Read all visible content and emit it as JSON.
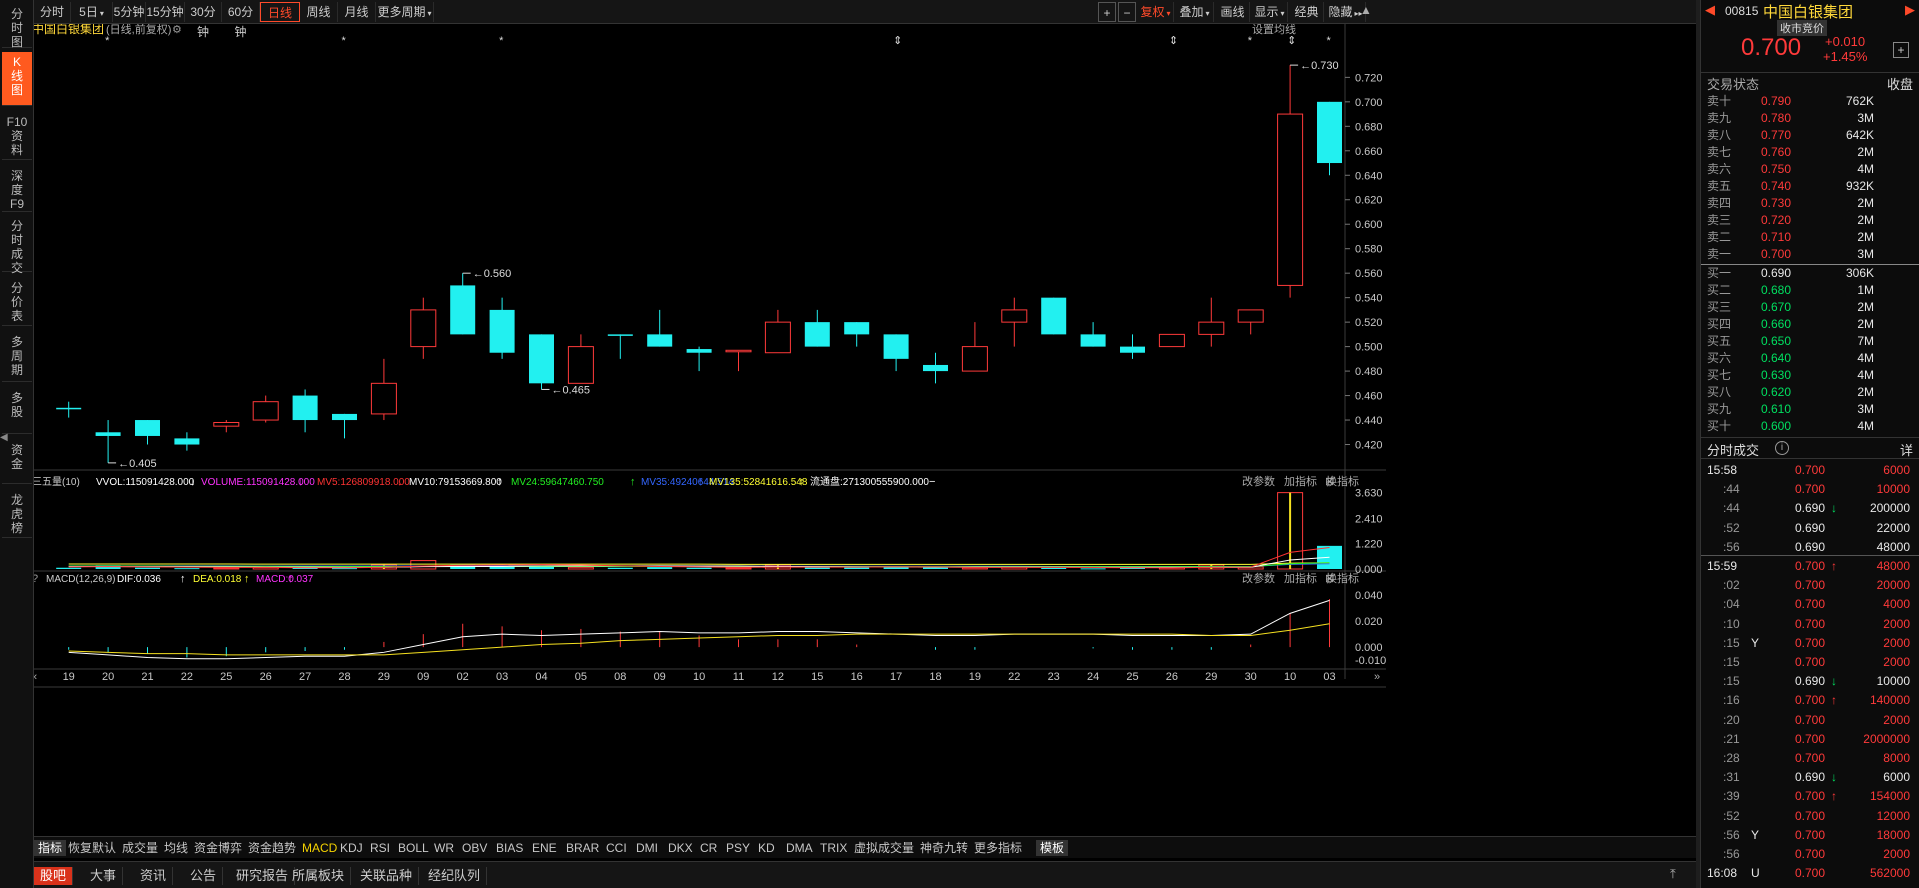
{
  "toolbar": {
    "left": [
      "分时",
      "5日",
      "5分钟",
      "15分钟",
      "30分钟",
      "60分钟",
      "日线",
      "周线",
      "月线",
      "更多周期"
    ],
    "right": [
      "+",
      "−",
      "复权",
      "叠加",
      "画线",
      "显示",
      "经典",
      "隐藏"
    ]
  },
  "leftnav": [
    {
      "label": "分\n时\n图"
    },
    {
      "label": "K\n线\n图"
    },
    {
      "label": "F10\n资\n料"
    },
    {
      "label": "深\n度\nF9"
    },
    {
      "label": "分\n时\n成\n交"
    },
    {
      "label": "分\n价\n表"
    },
    {
      "label": "多\n周\n期"
    },
    {
      "label": "多\n股"
    },
    {
      "label": "资\n金"
    },
    {
      "label": "龙\n虎\n榜"
    }
  ],
  "header": {
    "title": "中国白银集团",
    "subtitle": "(日线,前复权)",
    "settings": "设置均线"
  },
  "volume_header": {
    "name": "三五量(10)",
    "items": [
      "VVOL:115091428.000",
      "VOLUME:115091428.000",
      "MV5:126809918.000",
      "MV10:79153669.800",
      "MV24:59647460.750",
      "MV35:49240644.514",
      "MV135:52841616.548",
      "流通盘:271300555900.000"
    ],
    "colors": [
      "#ffffff",
      "#ff33ff",
      "#ff3333",
      "#ffffff",
      "#22ee22",
      "#3366ff",
      "#ffff33",
      "#ffffff"
    ],
    "arrows": [
      "↓",
      "↓",
      "↓",
      "↑",
      "↑",
      "↑",
      "↑",
      "−"
    ],
    "actions": [
      "改参数",
      "加指标",
      "换指标"
    ]
  },
  "macd_header": {
    "name": "MACD(12,26,9)",
    "items": [
      "DIF:0.036",
      "DEA:0.018",
      "MACD:0.037"
    ],
    "colors": [
      "#ffffff",
      "#ffff33",
      "#ff33ff"
    ],
    "arrows": [
      "↑",
      "↑",
      "↑"
    ],
    "actions": [
      "改参数",
      "加指标",
      "换指标"
    ]
  },
  "chart_data": {
    "type": "candlestick",
    "dates": [
      "19",
      "20",
      "21",
      "22",
      "25",
      "26",
      "27",
      "28",
      "29",
      "09",
      "02",
      "03",
      "04",
      "05",
      "08",
      "09",
      "10",
      "11",
      "12",
      "15",
      "16",
      "17",
      "18",
      "19",
      "22",
      "23",
      "24",
      "25",
      "26",
      "29",
      "30",
      "10",
      "03"
    ],
    "ohlc": [
      [
        0.45,
        0.455,
        0.442,
        0.45
      ],
      [
        0.43,
        0.44,
        0.405,
        0.427
      ],
      [
        0.44,
        0.44,
        0.42,
        0.427
      ],
      [
        0.425,
        0.43,
        0.415,
        0.42
      ],
      [
        0.435,
        0.44,
        0.43,
        0.438
      ],
      [
        0.44,
        0.46,
        0.438,
        0.455
      ],
      [
        0.46,
        0.465,
        0.43,
        0.44
      ],
      [
        0.445,
        0.445,
        0.425,
        0.44
      ],
      [
        0.445,
        0.49,
        0.44,
        0.47
      ],
      [
        0.5,
        0.54,
        0.49,
        0.53
      ],
      [
        0.55,
        0.56,
        0.51,
        0.51
      ],
      [
        0.53,
        0.54,
        0.49,
        0.495
      ],
      [
        0.51,
        0.51,
        0.465,
        0.47
      ],
      [
        0.47,
        0.51,
        0.47,
        0.5
      ],
      [
        0.51,
        0.51,
        0.49,
        0.51
      ],
      [
        0.51,
        0.53,
        0.5,
        0.5
      ],
      [
        0.498,
        0.5,
        0.48,
        0.495
      ],
      [
        0.496,
        0.497,
        0.48,
        0.497
      ],
      [
        0.495,
        0.53,
        0.495,
        0.52
      ],
      [
        0.52,
        0.53,
        0.5,
        0.5
      ],
      [
        0.52,
        0.52,
        0.5,
        0.51
      ],
      [
        0.51,
        0.51,
        0.48,
        0.49
      ],
      [
        0.485,
        0.495,
        0.47,
        0.48
      ],
      [
        0.48,
        0.52,
        0.48,
        0.5
      ],
      [
        0.52,
        0.54,
        0.5,
        0.53
      ],
      [
        0.54,
        0.54,
        0.51,
        0.51
      ],
      [
        0.51,
        0.52,
        0.5,
        0.5
      ],
      [
        0.5,
        0.51,
        0.49,
        0.495
      ],
      [
        0.5,
        0.51,
        0.5,
        0.51
      ],
      [
        0.51,
        0.54,
        0.5,
        0.52
      ],
      [
        0.52,
        0.53,
        0.51,
        0.53
      ],
      [
        0.55,
        0.73,
        0.54,
        0.69
      ],
      [
        0.7,
        0.7,
        0.64,
        0.65
      ]
    ],
    "y_ticks": [
      0.42,
      0.44,
      0.46,
      0.48,
      0.5,
      0.52,
      0.54,
      0.56,
      0.58,
      0.6,
      0.62,
      0.64,
      0.66,
      0.68,
      0.7,
      0.72
    ],
    "annotations": [
      {
        "label": "0.730",
        "i": 31
      },
      {
        "label": "0.560",
        "i": 10
      },
      {
        "label": "0.465",
        "i": 12
      },
      {
        "label": "0.405",
        "i": 1
      }
    ],
    "events": [
      {
        "mark": "*",
        "i": 1
      },
      {
        "mark": "*",
        "i": 7
      },
      {
        "mark": "*",
        "i": 11
      },
      {
        "mark": "⇕",
        "i": 21
      },
      {
        "mark": "⇕",
        "i": 28
      },
      {
        "mark": "*",
        "i": 30
      },
      {
        "mark": "⇕",
        "i": 31
      },
      {
        "mark": "*",
        "i": 32
      }
    ],
    "volume": {
      "values": [
        0.06,
        0.18,
        0.06,
        0.04,
        0.05,
        0.07,
        0.05,
        0.04,
        0.2,
        0.4,
        0.2,
        0.12,
        0.13,
        0.08,
        0.06,
        0.09,
        0.06,
        0.05,
        0.19,
        0.09,
        0.08,
        0.09,
        0.07,
        0.06,
        0.1,
        0.06,
        0.03,
        0.05,
        0.08,
        0.19,
        0.1,
        3.63,
        1.1
      ],
      "y_ticks": [
        0.0,
        1.22,
        2.41,
        3.63
      ],
      "mv5": [
        0.1,
        0.11,
        0.1,
        0.09,
        0.08,
        0.08,
        0.06,
        0.06,
        0.08,
        0.14,
        0.18,
        0.19,
        0.21,
        0.19,
        0.15,
        0.12,
        0.1,
        0.08,
        0.09,
        0.09,
        0.09,
        0.1,
        0.1,
        0.08,
        0.08,
        0.08,
        0.07,
        0.06,
        0.06,
        0.08,
        0.09,
        0.79,
        1.02
      ],
      "mv10": [
        0.12,
        0.12,
        0.11,
        0.11,
        0.1,
        0.09,
        0.09,
        0.08,
        0.08,
        0.11,
        0.12,
        0.12,
        0.14,
        0.15,
        0.15,
        0.15,
        0.14,
        0.14,
        0.12,
        0.11,
        0.1,
        0.1,
        0.09,
        0.09,
        0.09,
        0.09,
        0.08,
        0.08,
        0.08,
        0.08,
        0.08,
        0.43,
        0.56
      ],
      "mv24": [
        0.14,
        0.14,
        0.14,
        0.13,
        0.13,
        0.13,
        0.12,
        0.12,
        0.12,
        0.12,
        0.12,
        0.12,
        0.12,
        0.12,
        0.12,
        0.12,
        0.12,
        0.12,
        0.12,
        0.12,
        0.11,
        0.11,
        0.11,
        0.11,
        0.11,
        0.11,
        0.11,
        0.11,
        0.11,
        0.11,
        0.11,
        0.25,
        0.3
      ],
      "mv35": [
        0.15,
        0.15,
        0.15,
        0.15,
        0.15,
        0.14,
        0.14,
        0.14,
        0.14,
        0.14,
        0.14,
        0.14,
        0.14,
        0.14,
        0.14,
        0.14,
        0.14,
        0.13,
        0.13,
        0.13,
        0.13,
        0.13,
        0.13,
        0.13,
        0.13,
        0.12,
        0.12,
        0.12,
        0.12,
        0.12,
        0.12,
        0.22,
        0.25
      ],
      "mv135": [
        0.24,
        0.24,
        0.24,
        0.24,
        0.24,
        0.23,
        0.23,
        0.23,
        0.23,
        0.23,
        0.23,
        0.23,
        0.23,
        0.23,
        0.23,
        0.23,
        0.23,
        0.22,
        0.22,
        0.22,
        0.22,
        0.22,
        0.22,
        0.22,
        0.22,
        0.22,
        0.22,
        0.22,
        0.22,
        0.22,
        0.22,
        0.28,
        0.3
      ]
    },
    "macd": {
      "y_ticks": [
        -0.01,
        0.0,
        0.02,
        0.04
      ],
      "dif": [
        -0.004,
        -0.006,
        -0.008,
        -0.009,
        -0.009,
        -0.008,
        -0.007,
        -0.007,
        -0.004,
        0.002,
        0.008,
        0.01,
        0.009,
        0.01,
        0.011,
        0.012,
        0.011,
        0.011,
        0.012,
        0.012,
        0.011,
        0.01,
        0.009,
        0.009,
        0.01,
        0.01,
        0.01,
        0.009,
        0.009,
        0.009,
        0.01,
        0.026,
        0.036
      ],
      "dea": [
        -0.003,
        -0.004,
        -0.005,
        -0.005,
        -0.006,
        -0.006,
        -0.006,
        -0.006,
        -0.006,
        -0.004,
        -0.002,
        0.0,
        0.002,
        0.003,
        0.005,
        0.006,
        0.007,
        0.008,
        0.009,
        0.009,
        0.01,
        0.01,
        0.01,
        0.01,
        0.01,
        0.01,
        0.01,
        0.01,
        0.01,
        0.009,
        0.009,
        0.013,
        0.018
      ],
      "hist": [
        -0.002,
        -0.004,
        -0.005,
        -0.008,
        -0.007,
        -0.004,
        -0.003,
        -0.002,
        0.004,
        0.01,
        0.018,
        0.016,
        0.013,
        0.014,
        0.012,
        0.012,
        0.009,
        0.006,
        0.006,
        0.006,
        0.002,
        0.0,
        -0.002,
        -0.002,
        0.0,
        0.0,
        -0.001,
        -0.002,
        -0.002,
        -0.002,
        0.002,
        0.026,
        0.037
      ]
    }
  },
  "ind_tabs": [
    "指标",
    "恢复默认",
    "成交量",
    "均线",
    "资金博弈",
    "资金趋势",
    "MACD",
    "KDJ",
    "RSI",
    "BOLL",
    "WR",
    "OBV",
    "BIAS",
    "ENE",
    "BRAR",
    "CCI",
    "DMI",
    "DKX",
    "CR",
    "PSY",
    "KD",
    "DMA",
    "TRIX",
    "虚拟成交量",
    "神奇九转",
    "更多指标",
    "模板"
  ],
  "bot_tabs": [
    "股吧",
    "大事",
    "资讯",
    "公告",
    "研究报告",
    "所属板块",
    "关联品种",
    "经纪队列"
  ],
  "right": {
    "code": "00815",
    "name": "中国白银集团",
    "status": "收市竞价",
    "price": "0.700",
    "change": "+0.010",
    "pct": "+1.45%",
    "trade_state": "交易状态",
    "close_label": "收盘",
    "asks": [
      [
        "卖十",
        "0.790",
        "762K"
      ],
      [
        "卖九",
        "0.780",
        "3M"
      ],
      [
        "卖八",
        "0.770",
        "642K"
      ],
      [
        "卖七",
        "0.760",
        "2M"
      ],
      [
        "卖六",
        "0.750",
        "4M"
      ],
      [
        "卖五",
        "0.740",
        "932K"
      ],
      [
        "卖四",
        "0.730",
        "2M"
      ],
      [
        "卖三",
        "0.720",
        "2M"
      ],
      [
        "卖二",
        "0.710",
        "2M"
      ],
      [
        "卖一",
        "0.700",
        "3M"
      ]
    ],
    "bids": [
      [
        "买一",
        "0.690",
        "306K"
      ],
      [
        "买二",
        "0.680",
        "1M"
      ],
      [
        "买三",
        "0.670",
        "2M"
      ],
      [
        "买四",
        "0.660",
        "2M"
      ],
      [
        "买五",
        "0.650",
        "7M"
      ],
      [
        "买六",
        "0.640",
        "4M"
      ],
      [
        "买七",
        "0.630",
        "4M"
      ],
      [
        "买八",
        "0.620",
        "2M"
      ],
      [
        "买九",
        "0.610",
        "3M"
      ],
      [
        "买十",
        "0.600",
        "4M"
      ]
    ],
    "ticks_title": "分时成交",
    "ticks_detail": "详",
    "ticks": [
      [
        "15:58",
        "",
        "0.700",
        "",
        "6000"
      ],
      [
        ":44",
        "",
        "0.700",
        "",
        "10000"
      ],
      [
        ":44",
        "",
        "0.690",
        "↓",
        "200000"
      ],
      [
        ":52",
        "",
        "0.690",
        "",
        "22000"
      ],
      [
        ":56",
        "",
        "0.690",
        "",
        "48000"
      ],
      [
        "15:59",
        "",
        "0.700",
        "↑",
        "48000"
      ],
      [
        ":02",
        "",
        "0.700",
        "",
        "20000"
      ],
      [
        ":04",
        "",
        "0.700",
        "",
        "4000"
      ],
      [
        ":10",
        "",
        "0.700",
        "",
        "2000"
      ],
      [
        ":15",
        "Y",
        "0.700",
        "",
        "2000"
      ],
      [
        ":15",
        "",
        "0.700",
        "",
        "2000"
      ],
      [
        ":15",
        "",
        "0.690",
        "↓",
        "10000"
      ],
      [
        ":16",
        "",
        "0.700",
        "↑",
        "140000"
      ],
      [
        ":20",
        "",
        "0.700",
        "",
        "2000"
      ],
      [
        ":21",
        "",
        "0.700",
        "",
        "2000000"
      ],
      [
        ":28",
        "",
        "0.700",
        "",
        "8000"
      ],
      [
        ":31",
        "",
        "0.690",
        "↓",
        "6000"
      ],
      [
        ":39",
        "",
        "0.700",
        "↑",
        "154000"
      ],
      [
        ":52",
        "",
        "0.700",
        "",
        "12000"
      ],
      [
        ":56",
        "Y",
        "0.700",
        "",
        "18000"
      ],
      [
        ":56",
        "",
        "0.700",
        "",
        "2000"
      ],
      [
        "16:08",
        "U",
        "0.700",
        "",
        "562000"
      ]
    ]
  }
}
